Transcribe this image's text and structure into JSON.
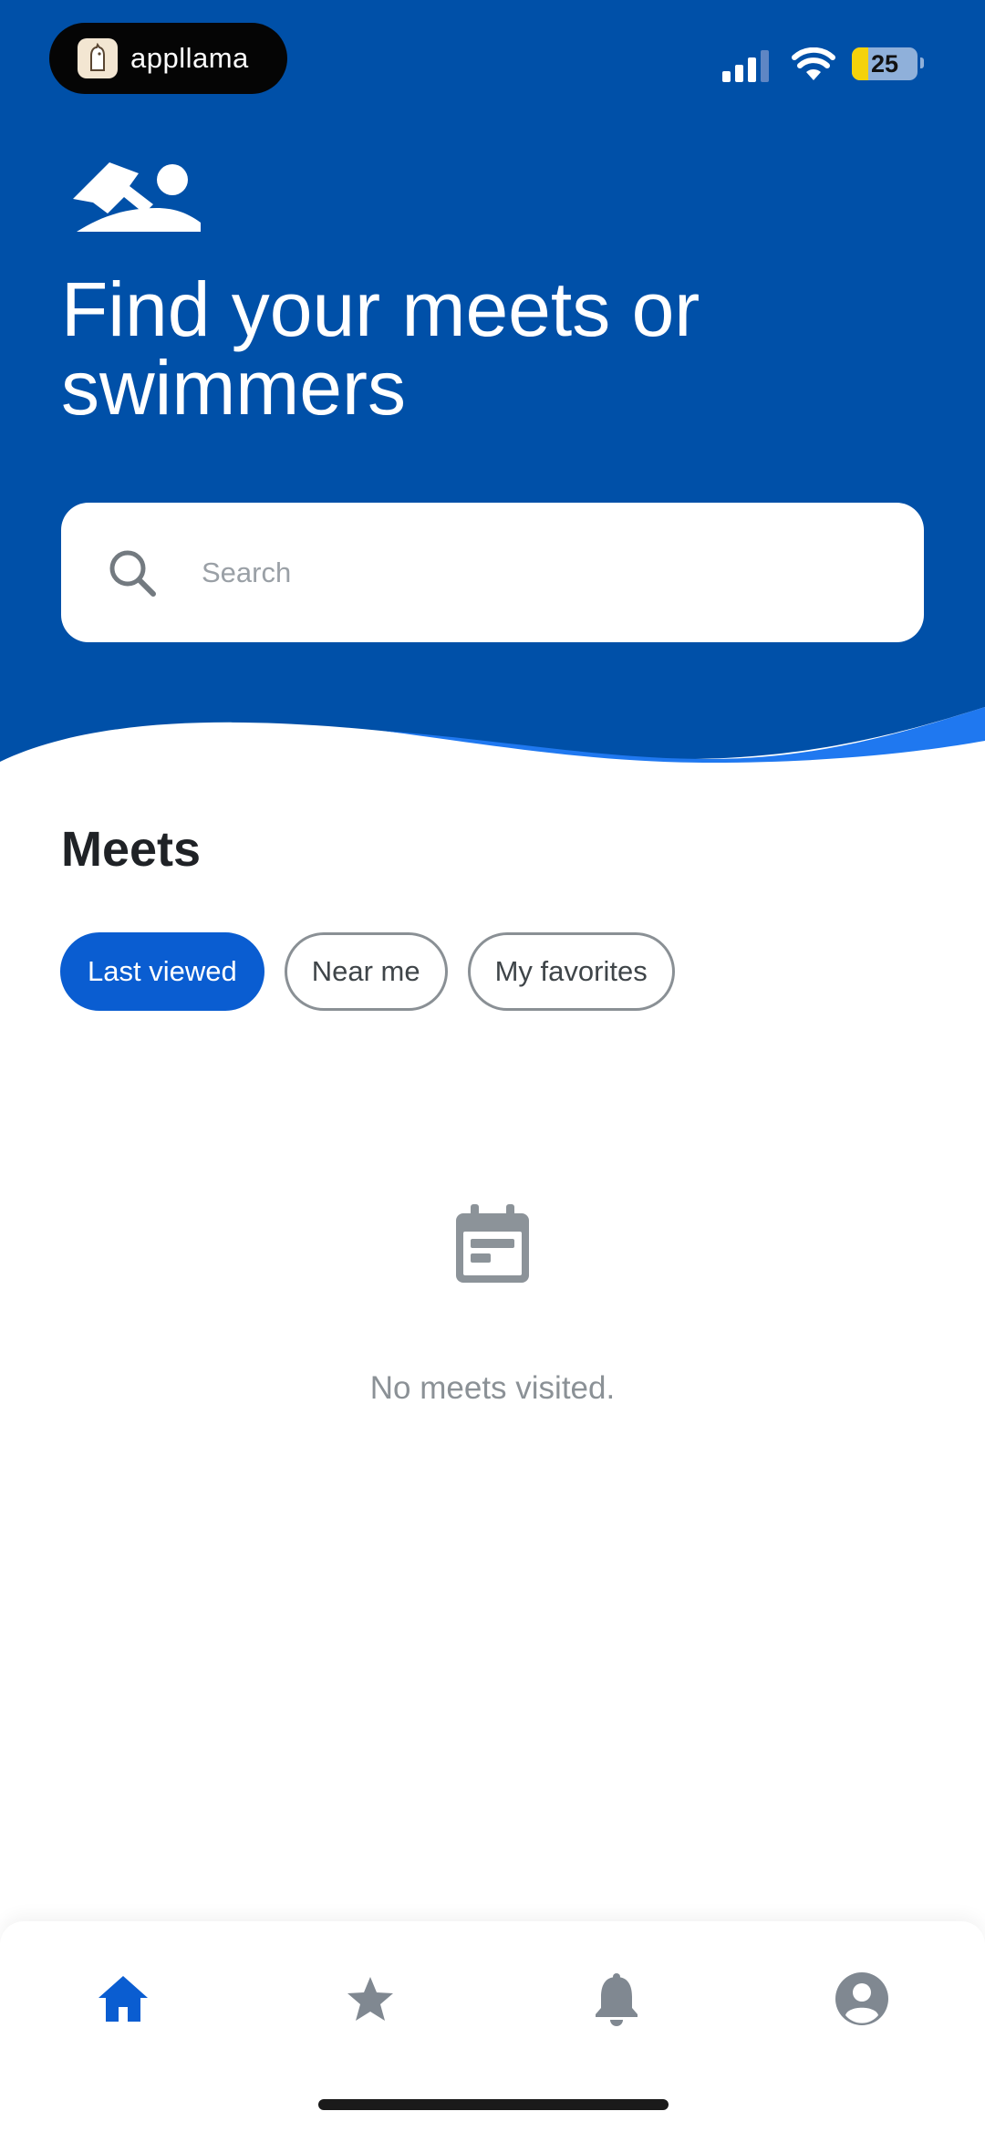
{
  "status_bar": {
    "app_pill_label": "appllama",
    "battery_level": "25",
    "battery_fraction": 0.25
  },
  "hero": {
    "title": "Find your meets or swimmers",
    "search_placeholder": "Search",
    "background_color": "#0050a8",
    "wave_accent_color": "#1f78f0"
  },
  "meets": {
    "section_title": "Meets",
    "chips": [
      {
        "label": "Last viewed",
        "active": true
      },
      {
        "label": "Near me",
        "active": false
      },
      {
        "label": "My favorites",
        "active": false
      }
    ],
    "empty_icon": "calendar-icon",
    "empty_message": "No meets visited."
  },
  "bottom_nav": {
    "items": [
      {
        "icon": "home-icon",
        "active": true
      },
      {
        "icon": "star-icon",
        "active": false
      },
      {
        "icon": "bell-icon",
        "active": false
      },
      {
        "icon": "account-icon",
        "active": false
      }
    ],
    "active_color": "#0a5dd1",
    "inactive_color": "#808891"
  }
}
